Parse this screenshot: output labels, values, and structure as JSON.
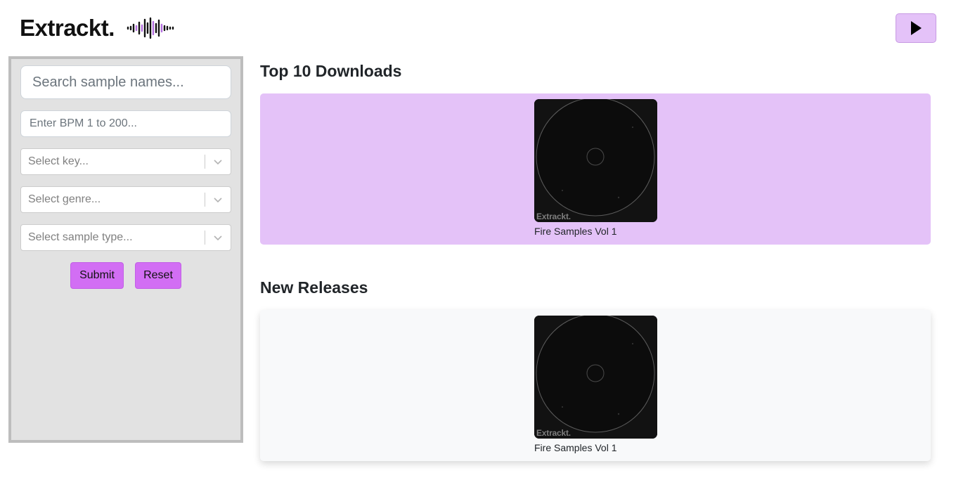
{
  "header": {
    "brand": "Extrackt.",
    "logo_icon": "soundwave-icon",
    "play_icon": "play-icon"
  },
  "sidebar": {
    "search_placeholder": "Search sample names...",
    "bpm_placeholder": "Enter BPM 1 to 200...",
    "key_placeholder": "Select key...",
    "genre_placeholder": "Select genre...",
    "type_placeholder": "Select sample type...",
    "submit_label": "Submit",
    "reset_label": "Reset"
  },
  "sections": {
    "top_downloads": {
      "title": "Top 10 Downloads",
      "items": [
        {
          "title": "Fire Samples Vol 1",
          "cover_mark": "Extrackt."
        }
      ]
    },
    "new_releases": {
      "title": "New Releases",
      "items": [
        {
          "title": "Fire Samples Vol 1",
          "cover_mark": "Extrackt."
        }
      ]
    }
  },
  "colors": {
    "accent": "#d26ef4",
    "accent_light": "#e4c2f8",
    "sidebar_bg": "#e2e2e2"
  }
}
